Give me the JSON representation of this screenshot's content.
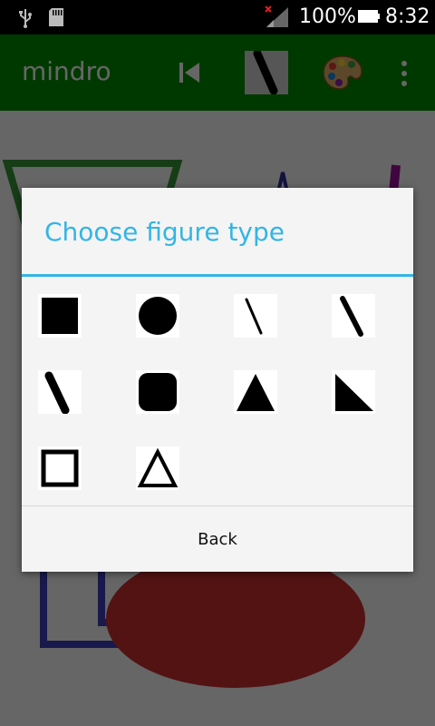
{
  "status_bar": {
    "battery_percent": "100%",
    "time": "8:32"
  },
  "app_bar": {
    "title": "mindro",
    "icons": [
      "skip-previous-icon",
      "line-tool-icon",
      "palette-icon",
      "overflow-menu-icon"
    ],
    "color": "#008f00"
  },
  "dialog": {
    "title": "Choose figure type",
    "accent_color": "#33b5e5",
    "shapes": [
      "filled-square-icon",
      "filled-circle-icon",
      "thin-line-icon",
      "medium-line-icon",
      "thick-line-icon",
      "filled-rounded-square-icon",
      "filled-triangle-icon",
      "filled-right-triangle-icon",
      "outline-square-icon",
      "outline-triangle-icon"
    ],
    "back_label": "Back"
  }
}
